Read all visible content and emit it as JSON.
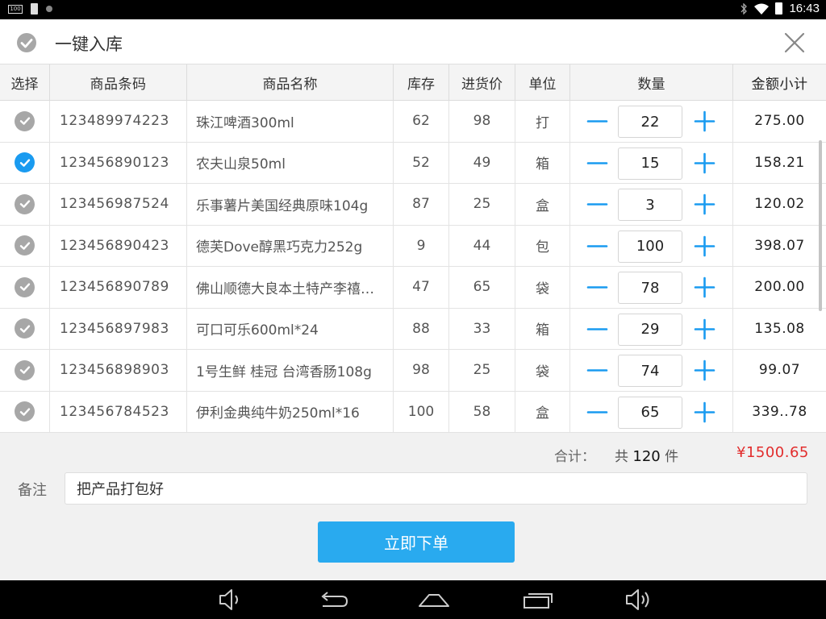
{
  "status_bar": {
    "battery_small": "100",
    "time": "16:43"
  },
  "header": {
    "title": "一键入库"
  },
  "table": {
    "columns": [
      "选择",
      "商品条码",
      "商品名称",
      "库存",
      "进货价",
      "单位",
      "数量",
      "金额小计"
    ],
    "rows": [
      {
        "selected": false,
        "barcode": "123489974223",
        "name": "珠江啤酒300ml",
        "stock": "62",
        "price": "98",
        "unit": "打",
        "qty": "22",
        "amount": "275.00"
      },
      {
        "selected": true,
        "barcode": "123456890123",
        "name": "农夫山泉50ml",
        "stock": "52",
        "price": "49",
        "unit": "箱",
        "qty": "15",
        "amount": "158.21"
      },
      {
        "selected": false,
        "barcode": "123456987524",
        "name": "乐事薯片美国经典原味104g",
        "stock": "87",
        "price": "25",
        "unit": "盒",
        "qty": "3",
        "amount": "120.02"
      },
      {
        "selected": false,
        "barcode": "123456890423",
        "name": "德芙Dove醇黑巧克力252g",
        "stock": "9",
        "price": "44",
        "unit": "包",
        "qty": "100",
        "amount": "398.07"
      },
      {
        "selected": false,
        "barcode": "123456890789",
        "name": "佛山顺德大良本土特产李禧…",
        "stock": "47",
        "price": "65",
        "unit": "袋",
        "qty": "78",
        "amount": "200.00"
      },
      {
        "selected": false,
        "barcode": "123456897983",
        "name": "可口可乐600ml*24",
        "stock": "88",
        "price": "33",
        "unit": "箱",
        "qty": "29",
        "amount": "135.08"
      },
      {
        "selected": false,
        "barcode": "123456898903",
        "name": "1号生鲜 桂冠 台湾香肠108g",
        "stock": "98",
        "price": "25",
        "unit": "袋",
        "qty": "74",
        "amount": "99.07"
      },
      {
        "selected": false,
        "barcode": "123456784523",
        "name": "伊利金典纯牛奶250ml*16",
        "stock": "100",
        "price": "58",
        "unit": "盒",
        "qty": "65",
        "amount": "339..78"
      }
    ]
  },
  "summary": {
    "label": "合计：",
    "count_prefix": "共",
    "count": "120",
    "count_suffix": "件",
    "total": "¥1500.65"
  },
  "remark": {
    "label": "备注",
    "value": "把产品打包好"
  },
  "actions": {
    "order_label": "立即下单"
  },
  "colors": {
    "accent": "#29aaef",
    "check_on": "#1a9bf0",
    "check_off": "#a7a7a7",
    "total_red": "#e22d2d"
  },
  "icons": [
    "check-icon",
    "close-icon",
    "minus-icon",
    "plus-icon",
    "volume-down-icon",
    "back-icon",
    "home-icon",
    "recents-icon",
    "volume-up-icon",
    "bluetooth-icon",
    "wifi-icon",
    "battery-icon"
  ]
}
